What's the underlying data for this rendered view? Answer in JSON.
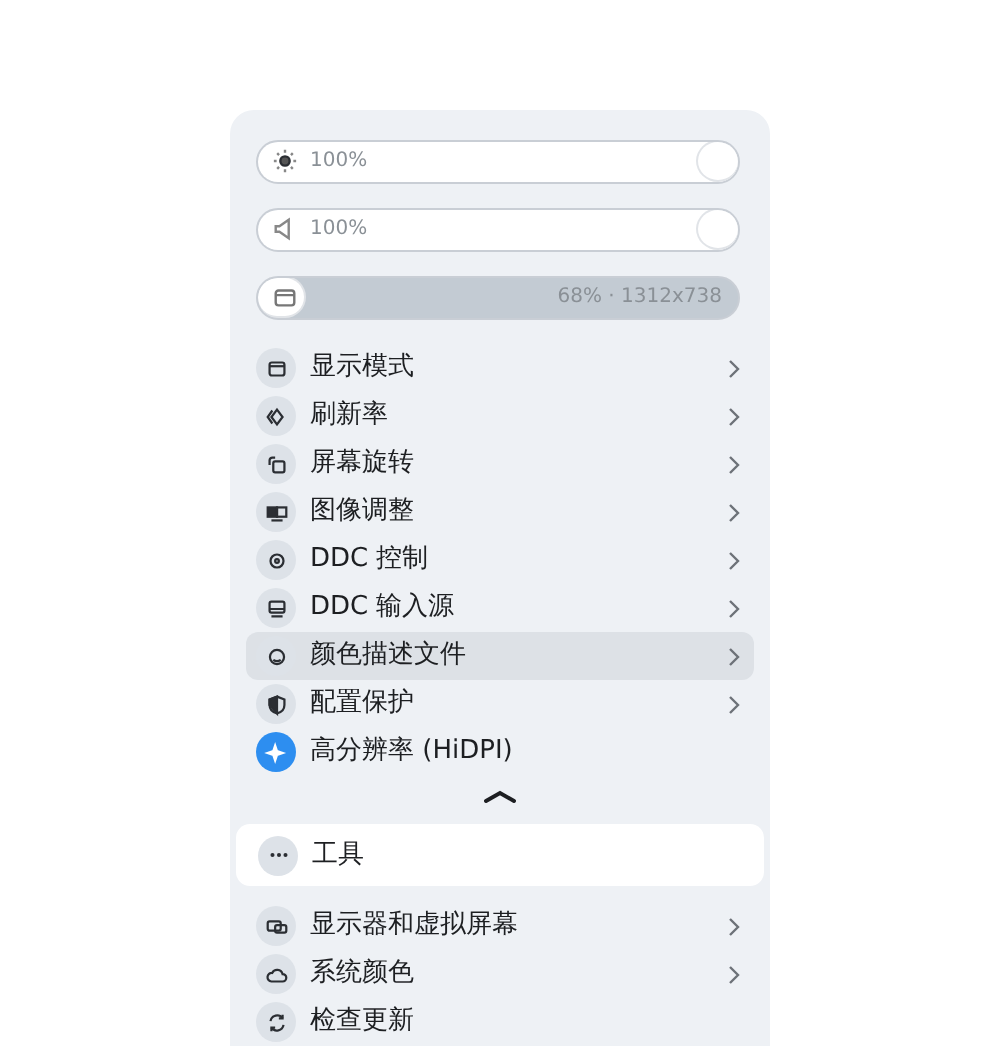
{
  "sliders": [
    {
      "kind": "brightness",
      "reading": "100%",
      "level": 1
    },
    {
      "kind": "volume",
      "reading": "100%",
      "level": 1
    },
    {
      "kind": "resolution",
      "reading": "68% · 1312x738"
    }
  ],
  "menu": [
    {
      "label": "显示模式",
      "submenu": true,
      "selected": false,
      "on": false
    },
    {
      "label": "刷新率",
      "submenu": true,
      "selected": false,
      "on": false
    },
    {
      "label": "屏幕旋转",
      "submenu": true,
      "selected": false,
      "on": false
    },
    {
      "label": "图像调整",
      "submenu": true,
      "selected": false,
      "on": false
    },
    {
      "label": "DDC 控制",
      "submenu": true,
      "selected": false,
      "on": false
    },
    {
      "label": "DDC 输入源",
      "submenu": true,
      "selected": false,
      "on": false
    },
    {
      "label": "颜色描述文件",
      "submenu": true,
      "selected": true,
      "on": false
    },
    {
      "label": "配置保护",
      "submenu": true,
      "selected": false,
      "on": false
    },
    {
      "label": "高分辨率 (HiDPI)",
      "submenu": false,
      "selected": false,
      "on": true
    }
  ],
  "collapse": {
    "expanded": true
  },
  "tools": {
    "label": "工具"
  },
  "more": [
    {
      "label": "显示器和虚拟屏幕",
      "submenu": true
    },
    {
      "label": "系统颜色",
      "submenu": true
    },
    {
      "label": "检查更新",
      "submenu": false
    }
  ]
}
